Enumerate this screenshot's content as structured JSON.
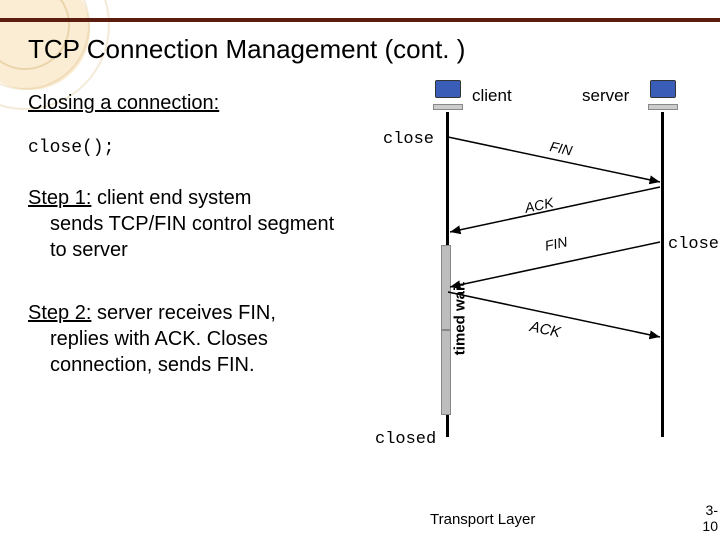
{
  "title": "TCP Connection Management (cont. )",
  "subtitle": "Closing a connection:",
  "codeline": "close();",
  "step1": {
    "heading": "Step 1:",
    "lead": " client end system",
    "body": "sends TCP/FIN control segment to server"
  },
  "step2": {
    "heading": "Step 2:",
    "lead": " server receives FIN,",
    "body": "replies with ACK. Closes connection, sends FIN."
  },
  "diagram": {
    "client_label": "client",
    "server_label": "server",
    "events": {
      "close_client": "close",
      "close_server": "close",
      "closed": "closed"
    },
    "messages": {
      "fin1": "FIN",
      "ack1": "ACK",
      "fin2": "FIN",
      "ack2": "ACK"
    },
    "timed_wait": "timed wait"
  },
  "footer": "Transport Layer",
  "page": {
    "chapter": "3-",
    "num": "10"
  }
}
